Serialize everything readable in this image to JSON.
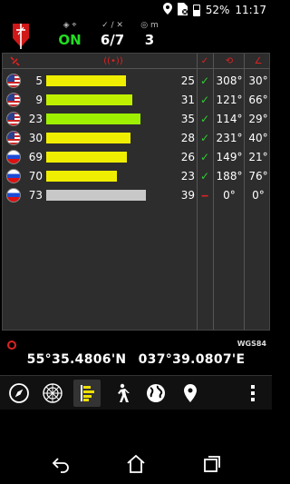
{
  "status_bar": {
    "battery": "52%",
    "time": "11:17",
    "icons": [
      "location-icon",
      "sim-icon",
      "battery-icon"
    ]
  },
  "top_bar": {
    "fix_status": "ON",
    "satellites": "6/7",
    "accuracy_unit": "m",
    "accuracy": "3"
  },
  "satellites": [
    {
      "flag": "us",
      "prn": "5",
      "snr": "25",
      "used": "✓",
      "azimuth": "308°",
      "elevation": "30°",
      "bar_fraction": 0.71,
      "bar_color": "#f0ee00"
    },
    {
      "flag": "us",
      "prn": "9",
      "snr": "31",
      "used": "✓",
      "azimuth": "121°",
      "elevation": "66°",
      "bar_fraction": 0.77,
      "bar_color": "#bff000"
    },
    {
      "flag": "us",
      "prn": "23",
      "snr": "35",
      "used": "✓",
      "azimuth": "114°",
      "elevation": "29°",
      "bar_fraction": 0.84,
      "bar_color": "#9ef000"
    },
    {
      "flag": "us",
      "prn": "30",
      "snr": "28",
      "used": "✓",
      "azimuth": "231°",
      "elevation": "40°",
      "bar_fraction": 0.75,
      "bar_color": "#f0ee00"
    },
    {
      "flag": "ru",
      "prn": "69",
      "snr": "26",
      "used": "✓",
      "azimuth": "149°",
      "elevation": "21°",
      "bar_fraction": 0.72,
      "bar_color": "#f0ee00"
    },
    {
      "flag": "ru",
      "prn": "70",
      "snr": "23",
      "used": "✓",
      "azimuth": "188°",
      "elevation": "76°",
      "bar_fraction": 0.63,
      "bar_color": "#f0ee00"
    },
    {
      "flag": "ru",
      "prn": "73",
      "snr": "39",
      "used": "‒",
      "azimuth": "0°",
      "elevation": "0°",
      "bar_fraction": 0.89,
      "bar_color": "#c8c8c8"
    }
  ],
  "coordinates": {
    "datum": "WGS84",
    "latitude": "55°35.4806'N",
    "longitude": "037°39.0807'E"
  },
  "toolbar": {
    "items": [
      "compass-icon",
      "sky-view-icon",
      "signal-bars-icon",
      "walker-icon",
      "globe-icon",
      "map-pin-icon",
      "more-vert-icon"
    ],
    "active": "signal-bars-icon"
  },
  "navigation": {
    "items": [
      "back-icon",
      "home-icon",
      "recents-icon"
    ]
  }
}
